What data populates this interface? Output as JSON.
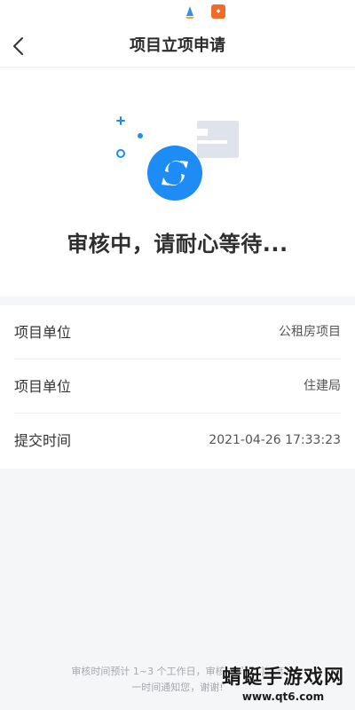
{
  "statusbar": {
    "icons": [
      "app-icon",
      "app-badge-icon"
    ]
  },
  "navbar": {
    "title": "项目立项申请",
    "back_icon": "chevron-left-icon"
  },
  "hero": {
    "icon": "refresh-icon",
    "message": "审核中，请耐心等待...",
    "accent_color": "#1e8cf5"
  },
  "info": {
    "rows": [
      {
        "label": "项目单位",
        "value": "公租房项目"
      },
      {
        "label": "项目单位",
        "value": "住建局"
      },
      {
        "label": "提交时间",
        "value": "2021-04-26 17:33:23"
      }
    ]
  },
  "footer": {
    "line1": "审核时间预计 1~3 个工作日，审核结果我们将第",
    "line2": "一时间通知您，谢谢!"
  },
  "watermark": {
    "title": "蜻蜓手游戏网",
    "url": "www.qt6.com"
  }
}
